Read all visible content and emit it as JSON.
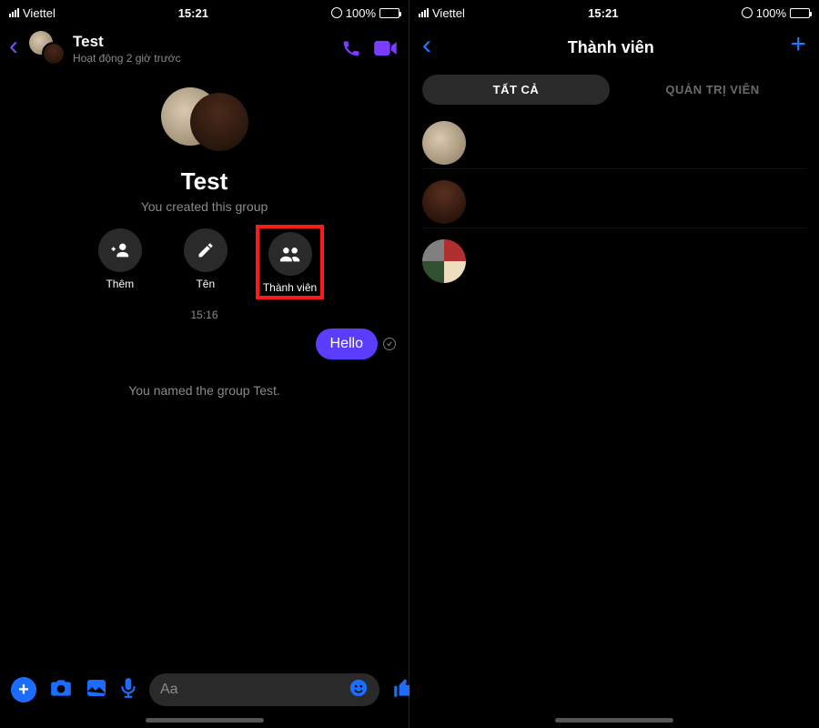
{
  "status": {
    "carrier": "Viettel",
    "time": "15:21",
    "battery_pct": "100%"
  },
  "chat": {
    "title": "Test",
    "subtitle": "Hoạt động 2 giờ trước",
    "group_name": "Test",
    "group_subtitle": "You created this group",
    "actions": {
      "add": "Thêm",
      "rename": "Tên",
      "members": "Thành viên"
    },
    "timestamp": "15:16",
    "message": "Hello",
    "system_msg": "You named the group Test.",
    "composer_placeholder": "Aa"
  },
  "members": {
    "title": "Thành viên",
    "tab_all": "TẤT CẢ",
    "tab_admin": "QUẢN TRỊ VIÊN"
  }
}
